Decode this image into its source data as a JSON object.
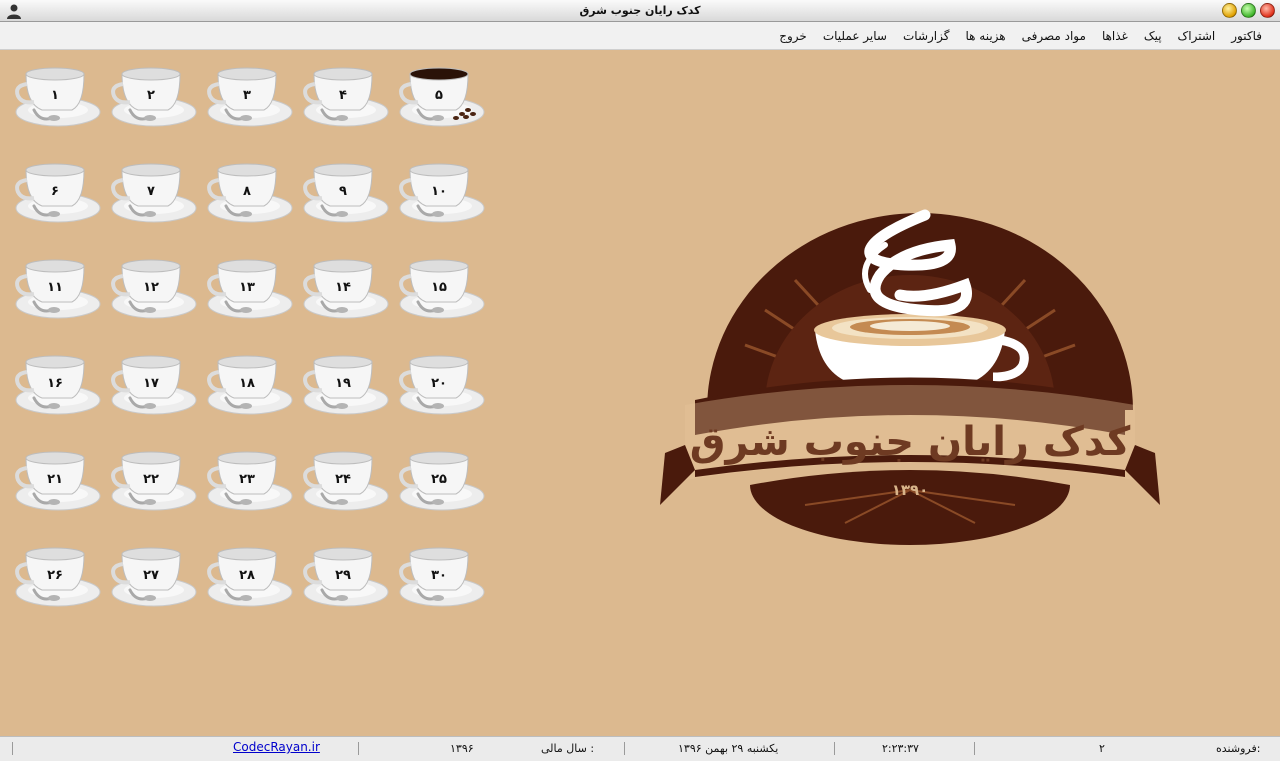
{
  "window": {
    "title": "کدک رایان جنوب شرق"
  },
  "menu": {
    "items": [
      "فاکتور",
      "اشتراک",
      "پیک",
      "غذاها",
      "مواد مصرفی",
      "هزینه ها",
      "گزارشات",
      "سایر عملیات",
      "خروج"
    ]
  },
  "tables": {
    "labels": [
      "۱",
      "۲",
      "۳",
      "۴",
      "۵",
      "۶",
      "۷",
      "۸",
      "۹",
      "۱۰",
      "۱۱",
      "۱۲",
      "۱۳",
      "۱۴",
      "۱۵",
      "۱۶",
      "۱۷",
      "۱۸",
      "۱۹",
      "۲۰",
      "۲۱",
      "۲۲",
      "۲۳",
      "۲۴",
      "۲۵",
      "۲۶",
      "۲۷",
      "۲۸",
      "۲۹",
      "۳۰"
    ],
    "occupied": [
      "۵"
    ]
  },
  "logo": {
    "name": "کدک رایان جنوب شرق",
    "year": "۱۳۹۰"
  },
  "status": {
    "seller_label": "فروشنده:",
    "seller_value": "۲",
    "time": "۲:۲۳:۳۷",
    "date": "یکشنبه ۲۹ بهمن ۱۳۹۶",
    "fiscal_label": "سال مالی :",
    "fiscal_value": "۱۳۹۶",
    "link": "CodecRayan.ir"
  },
  "colors": {
    "background": "#dcb98f",
    "logo_dark": "#4a1a0c",
    "logo_mid": "#7a3a1e",
    "logo_light": "#f0d2a8"
  }
}
